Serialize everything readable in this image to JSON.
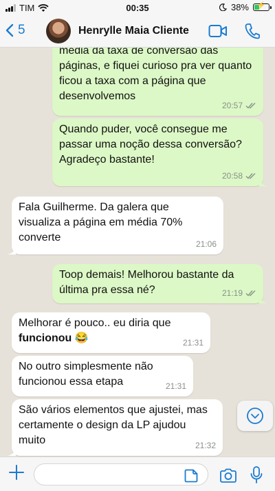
{
  "status_bar": {
    "carrier": "TIM",
    "time": "00:35",
    "battery": "38%",
    "battery_level": 0.38
  },
  "header": {
    "back_count": "5",
    "contact_name": "Henrylle Maia Cliente"
  },
  "messages": [
    {
      "direction": "out",
      "text": "média da taxa de conversão das páginas, e fiquei curioso pra ver quanto ficou a taxa com a página que desenvolvemos",
      "time": "20:57",
      "read": true
    },
    {
      "direction": "out",
      "text": "Quando puder, você consegue me passar uma noção dessa conversão? Agradeço bastante!",
      "time": "20:58",
      "read": true
    },
    {
      "direction": "in",
      "text": "Fala Guilherme. Da galera que visualiza a página em média 70% converte",
      "time": "21:06"
    },
    {
      "direction": "out",
      "text": "Toop demais! Melhorou bastante da última pra essa né?",
      "time": "21:19",
      "read": true
    },
    {
      "direction": "in",
      "text_before": "Melhorar é pouco.. eu diria que ",
      "text_bold": "funcionou",
      "emoji": "😂",
      "time": "21:31"
    },
    {
      "direction": "in",
      "text": "No outro simplesmente não funcionou essa etapa",
      "time": "21:31"
    },
    {
      "direction": "in",
      "text": "São vários elementos que ajustei, mas certamente o design da LP ajudou muito",
      "time": "21:32"
    }
  ],
  "input": {
    "placeholder": "",
    "value": ""
  },
  "colors": {
    "accent": "#1a7bd1",
    "outgoing": "#dcf8c6",
    "incoming": "#ffffff",
    "wallpaper": "#e7e2d9",
    "read_ticks": "#8a8f8a"
  }
}
